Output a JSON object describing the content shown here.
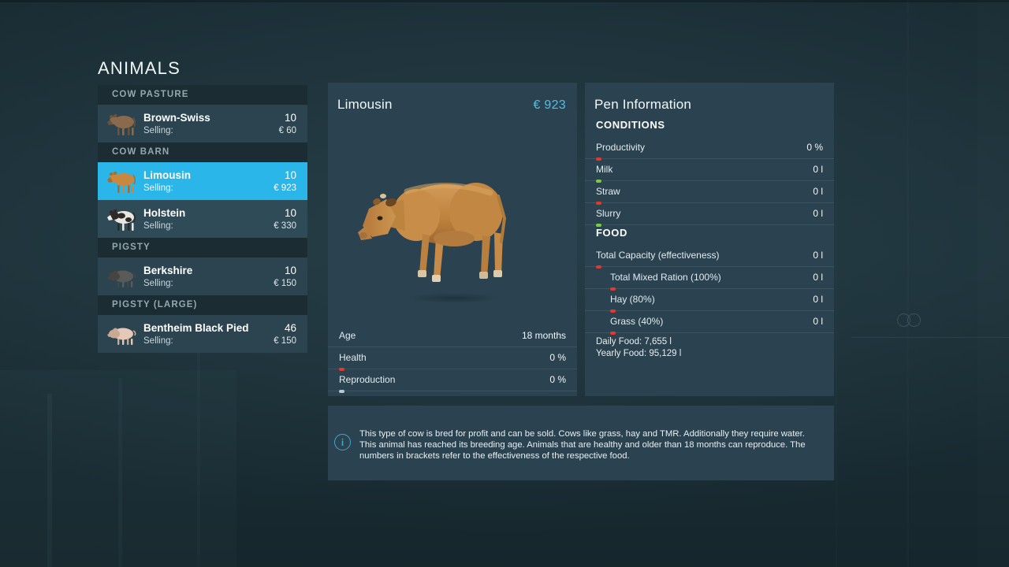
{
  "page_title": "ANIMALS",
  "colors": {
    "background": "#1d3038",
    "panel": "#2b4350",
    "row": "#2b4450",
    "row_alt": "#2f4b58",
    "section_header": "#1b2c33",
    "selected": "#2ab6e8",
    "accent_price": "#4ec0e8",
    "status_red": "#e0392f",
    "status_green": "#7ec943",
    "status_grey": "#b9c8cd",
    "info_icon": "#3ea9cd"
  },
  "sidebar": {
    "sections": [
      {
        "header": "COW PASTURE",
        "items": [
          {
            "name": "Brown-Swiss",
            "count": "10",
            "selling_label": "Selling:",
            "price": "€ 60",
            "selected": false,
            "icon": "cow-brown-swiss-icon",
            "coat": "#8a6a4a",
            "coat2": "#6d5239"
          }
        ]
      },
      {
        "header": "COW BARN",
        "items": [
          {
            "name": "Limousin",
            "count": "10",
            "selling_label": "Selling:",
            "price": "€ 923",
            "selected": true,
            "icon": "cow-limousin-icon",
            "coat": "#c9883f",
            "coat2": "#a96c2c"
          },
          {
            "name": "Holstein",
            "count": "10",
            "selling_label": "Selling:",
            "price": "€ 330",
            "selected": false,
            "icon": "cow-holstein-icon",
            "coat": "#e9e6df",
            "coat2": "#2e2b27"
          }
        ]
      },
      {
        "header": "PIGSTY",
        "items": [
          {
            "name": "Berkshire",
            "count": "10",
            "selling_label": "Selling:",
            "price": "€ 150",
            "selected": false,
            "icon": "pig-berkshire-icon",
            "coat": "#5a5a58",
            "coat2": "#454543"
          }
        ]
      },
      {
        "header": "PIGSTY (LARGE)",
        "items": [
          {
            "name": "Bentheim Black Pied",
            "count": "46",
            "selling_label": "Selling:",
            "price": "€ 150",
            "selected": false,
            "icon": "pig-bentheim-black-pied-icon",
            "coat": "#e4c9b8",
            "coat2": "#c9a894"
          }
        ]
      }
    ]
  },
  "detail": {
    "title": "Limousin",
    "price": "€ 923",
    "animal_render": "limousin-cow-3d-render",
    "stats": [
      {
        "label": "Age",
        "value": "18 months",
        "indicator": "none"
      },
      {
        "label": "Health",
        "value": "0 %",
        "indicator": "red"
      },
      {
        "label": "Reproduction",
        "value": "0 %",
        "indicator": "grey"
      }
    ]
  },
  "pen": {
    "title": "Pen Information",
    "conditions_header": "CONDITIONS",
    "conditions": [
      {
        "label": "Productivity",
        "value": "0 %",
        "indicator": "red"
      },
      {
        "label": "Milk",
        "value": "0 l",
        "indicator": "green"
      },
      {
        "label": "Straw",
        "value": "0 l",
        "indicator": "red"
      },
      {
        "label": "Slurry",
        "value": "0 l",
        "indicator": "green"
      }
    ],
    "food_header": "FOOD",
    "food": [
      {
        "label": "Total Capacity (effectiveness)",
        "value": "0 l",
        "indicator": "red",
        "indent": false
      },
      {
        "label": "Total Mixed Ration (100%)",
        "value": "0 l",
        "indicator": "red",
        "indent": true
      },
      {
        "label": "Hay (80%)",
        "value": "0 l",
        "indicator": "red",
        "indent": true
      },
      {
        "label": "Grass (40%)",
        "value": "0 l",
        "indicator": "red",
        "indent": true
      }
    ],
    "daily_food": "Daily Food: 7,655 l",
    "yearly_food": "Yearly Food: 95,129 l"
  },
  "info": {
    "icon": "information-icon",
    "glyph": "i",
    "text": "This type of cow is bred for profit and can be sold. Cows like grass, hay and TMR. Additionally they require water. This animal has reached its breeding age. Animals that are healthy and older than 18 months can reproduce. The numbers in brackets refer to the effectiveness of the respective food."
  }
}
